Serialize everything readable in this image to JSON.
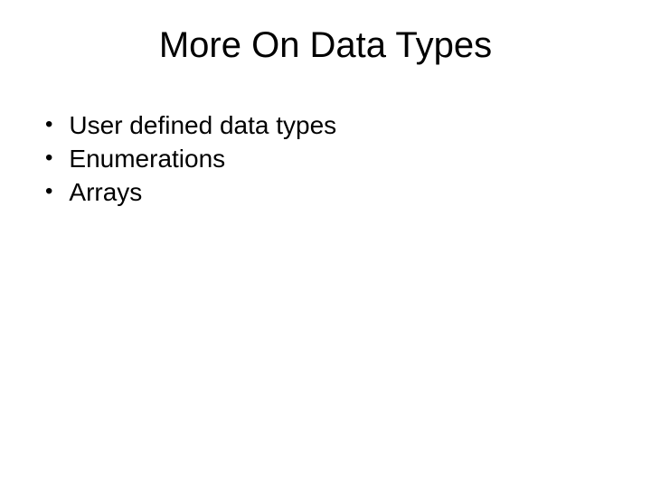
{
  "slide": {
    "title": "More On Data Types",
    "bullets": [
      "User defined data types",
      "Enumerations",
      "Arrays"
    ]
  }
}
